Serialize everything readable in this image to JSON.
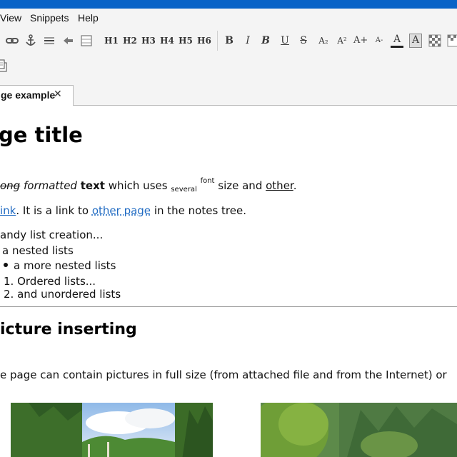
{
  "menu": {
    "items": [
      "View",
      "Snippets",
      "Help"
    ]
  },
  "toolbar": {
    "headings": [
      "H1",
      "H2",
      "H3",
      "H4",
      "H5",
      "H6"
    ],
    "format_glyphs": {
      "bold": "B",
      "italic": "I",
      "bold_italic": "B",
      "underline": "U",
      "strike": "S",
      "sub": "A₂",
      "sup": "A²",
      "bigger": "A+",
      "smaller": "A-",
      "color": "A",
      "bg": "A"
    }
  },
  "tab": {
    "label": "ge example",
    "close": "✕"
  },
  "doc": {
    "title": "ge title",
    "line1": {
      "strike": "ong",
      "italic": "formatted",
      "bold": "text",
      "plain1": "which uses",
      "sub": "several",
      "sup": "font",
      "plain2": "size and",
      "underline": "other",
      "end": "."
    },
    "line2": {
      "link1": "ink",
      "plain1": ". It is a link to",
      "link2": "other page",
      "plain2": "in the notes tree."
    },
    "list": {
      "intro": "andy list creation...",
      "nested": "a nested lists",
      "more_nested": "a more nested lists",
      "ordered1_num": "1.",
      "ordered1": "Ordered lists...",
      "ordered2_num": "2.",
      "ordered2": "and unordered lists"
    },
    "heading2": "icture inserting",
    "paragraph": "e page can contain pictures in full size (from attached file and from the Internet) or"
  },
  "colors": {
    "titlebar": "#0a63c7",
    "link": "#1f6ac2",
    "toolbar_bg": "#f4f4f4"
  }
}
